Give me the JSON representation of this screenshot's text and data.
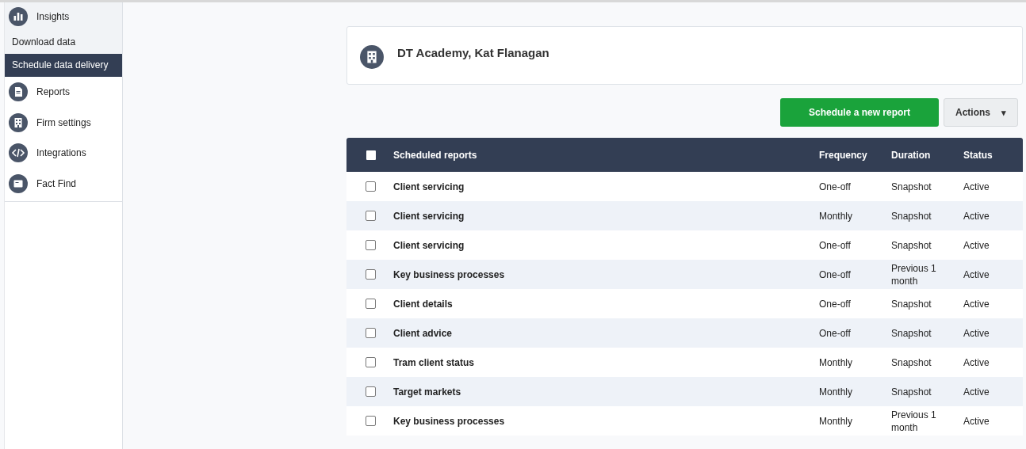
{
  "sidebar": {
    "items": [
      {
        "label": "Insights",
        "kind": "chart",
        "expanded": true,
        "children": [
          {
            "label": "Download data",
            "selected": false
          },
          {
            "label": "Schedule data delivery",
            "selected": true
          }
        ]
      },
      {
        "label": "Reports",
        "kind": "document",
        "expanded": false
      },
      {
        "label": "Firm settings",
        "kind": "building",
        "expanded": false
      },
      {
        "label": "Integrations",
        "kind": "code",
        "expanded": false
      },
      {
        "label": "Fact Find",
        "kind": "folder",
        "expanded": false
      }
    ]
  },
  "firm_card": {
    "title": "DT Academy, Kat Flanagan"
  },
  "buttons": {
    "primary": "Schedule a new report",
    "actions": "Actions",
    "actions_caret": "▾"
  },
  "table": {
    "select_all_checked": false,
    "columns": [
      "Scheduled reports",
      "Frequency",
      "Duration",
      "Status"
    ],
    "rows": [
      {
        "checked": false,
        "name": "Client servicing",
        "frequency": "One-off",
        "duration": "Snapshot",
        "status": "Active"
      },
      {
        "checked": false,
        "name": "Client servicing",
        "frequency": "Monthly",
        "duration": "Snapshot",
        "status": "Active"
      },
      {
        "checked": false,
        "name": "Client servicing",
        "frequency": "One-off",
        "duration": "Snapshot",
        "status": "Active"
      },
      {
        "checked": false,
        "name": "Key business processes",
        "frequency": "One-off",
        "duration": "Previous 1 month",
        "status": "Active"
      },
      {
        "checked": false,
        "name": "Client details",
        "frequency": "One-off",
        "duration": "Snapshot",
        "status": "Active"
      },
      {
        "checked": false,
        "name": "Client advice",
        "frequency": "One-off",
        "duration": "Snapshot",
        "status": "Active"
      },
      {
        "checked": false,
        "name": "Tram client status",
        "frequency": "Monthly",
        "duration": "Snapshot",
        "status": "Active"
      },
      {
        "checked": false,
        "name": "Target markets",
        "frequency": "Monthly",
        "duration": "Snapshot",
        "status": "Active"
      },
      {
        "checked": false,
        "name": "Key business processes",
        "frequency": "Monthly",
        "duration": "Previous 1 month",
        "status": "Active"
      }
    ]
  }
}
